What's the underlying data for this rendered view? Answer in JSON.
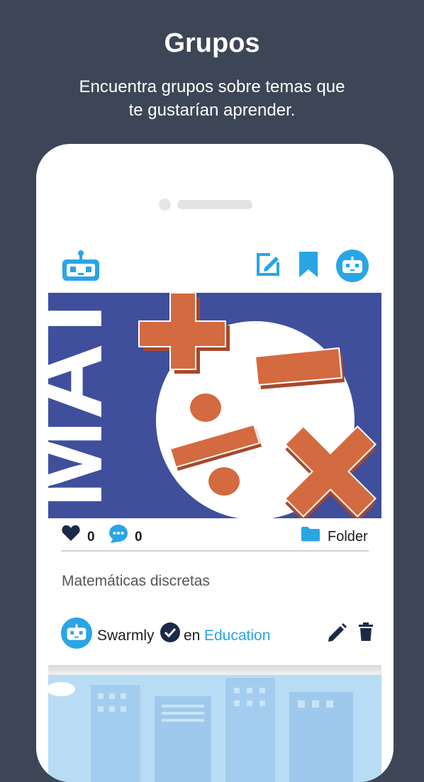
{
  "header": {
    "title": "Grupos",
    "subtitle": "Encuentra grupos sobre temas que te gustarían aprender."
  },
  "app": {
    "toolbar": {
      "logo_icon": "robot-icon",
      "actions": [
        "edit-icon",
        "bookmark-icon",
        "profile-robot-icon"
      ]
    },
    "post": {
      "cover_text": "MATH",
      "likes": "0",
      "comments": "0",
      "folder_label": "Folder",
      "group_name": "Matemáticas discretas",
      "author": "Swarmly",
      "preposition": "en",
      "category": "Education"
    }
  },
  "colors": {
    "background": "#3d4656",
    "accent": "#2aa5e4",
    "cover_bg": "#3f4f9c",
    "math_orange": "#d46a3f",
    "dark": "#1d1d1d"
  }
}
